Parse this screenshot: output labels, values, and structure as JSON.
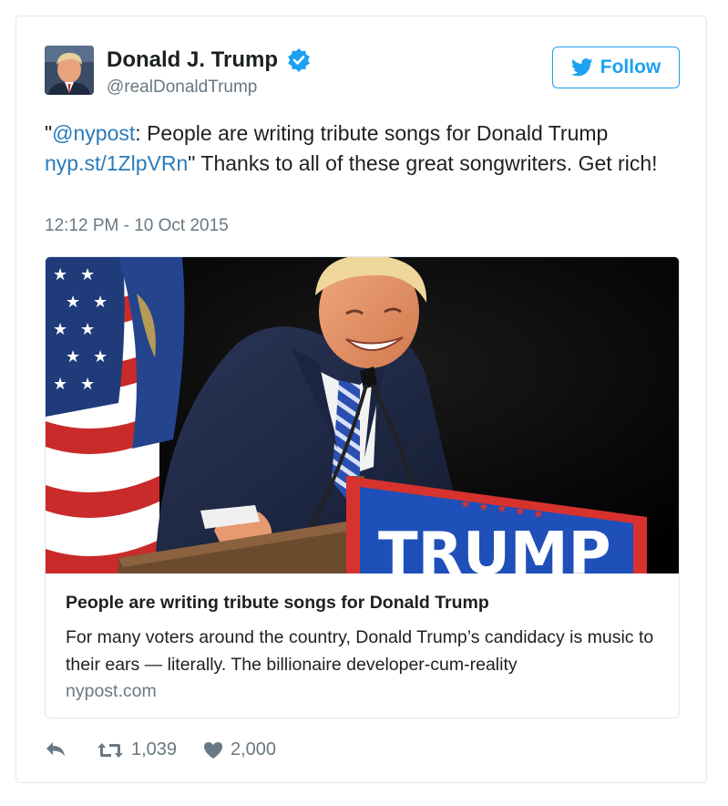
{
  "author": {
    "name": "Donald J. Trump",
    "handle": "@realDonaldTrump",
    "verified": true
  },
  "follow": {
    "label": "Follow",
    "icon": "twitter-bird-icon"
  },
  "tweet": {
    "text_parts": {
      "quote_open": "\"",
      "mention": "@nypost",
      "text_a": ": People are writing tribute songs for Donald Trump ",
      "link": "nyp.st/1ZlpVRn",
      "text_b": "\" Thanks to all of these great songwriters. Get rich!"
    },
    "timestamp": "12:12 PM - 10 Oct 2015"
  },
  "card": {
    "title": "People are writing tribute songs for Donald Trump",
    "description": "For many voters around the country, Donald Trump’s candidacy is music to their ears — literally. The billionaire developer-cum-reality",
    "domain": "nypost.com",
    "podium_text": "TRUMP"
  },
  "actions": {
    "reply_icon": "reply-icon",
    "retweet_icon": "retweet-icon",
    "retweet_count": "1,039",
    "like_icon": "heart-icon",
    "like_count": "2,000"
  },
  "colors": {
    "link": "#2b7bb9",
    "accent": "#1da1f2",
    "muted": "#697882",
    "border": "#e1e8ed"
  }
}
